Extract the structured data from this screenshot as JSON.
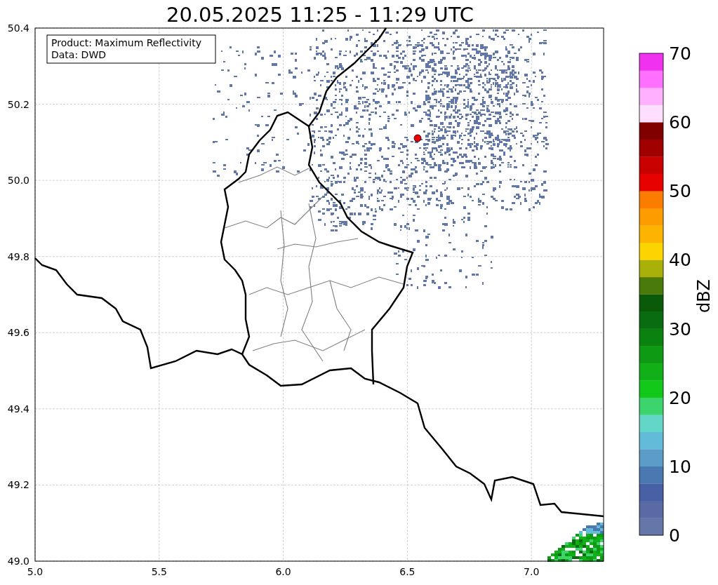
{
  "title": "20.05.2025 11:25 - 11:29 UTC",
  "info_box": [
    "Product: Maximum Reflectivity",
    "Data: DWD"
  ],
  "x_axis": {
    "ticks": [
      "5.0",
      "5.5",
      "6.0",
      "6.5",
      "7.0"
    ]
  },
  "y_axis": {
    "ticks": [
      "50.4",
      "50.2",
      "50.0",
      "49.8",
      "49.6",
      "49.4",
      "49.2",
      "49.0"
    ]
  },
  "colorbar": {
    "label": "dBZ",
    "ticks": [
      "70",
      "60",
      "50",
      "40",
      "30",
      "20",
      "10",
      "0"
    ],
    "segments": [
      {
        "color": "#6577a8"
      },
      {
        "color": "#5a6aa5"
      },
      {
        "color": "#4660a3"
      },
      {
        "color": "#4a78b0"
      },
      {
        "color": "#5c9cc8"
      },
      {
        "color": "#62bbd8"
      },
      {
        "color": "#64d6c8"
      },
      {
        "color": "#3dd46e"
      },
      {
        "color": "#12c818"
      },
      {
        "color": "#12b018"
      },
      {
        "color": "#0f9a14"
      },
      {
        "color": "#0a8210"
      },
      {
        "color": "#0a6c10"
      },
      {
        "color": "#0a5a0a"
      },
      {
        "color": "#4a7a0a"
      },
      {
        "color": "#aab00a"
      },
      {
        "color": "#fcd400"
      },
      {
        "color": "#fcb400"
      },
      {
        "color": "#fc9c00"
      },
      {
        "color": "#fc7c00"
      },
      {
        "color": "#e60000"
      },
      {
        "color": "#c80000"
      },
      {
        "color": "#a00000"
      },
      {
        "color": "#800000"
      },
      {
        "color": "#ffdfff"
      },
      {
        "color": "#ffb0ff"
      },
      {
        "color": "#ff70ff"
      },
      {
        "color": "#f032f0"
      }
    ]
  }
}
